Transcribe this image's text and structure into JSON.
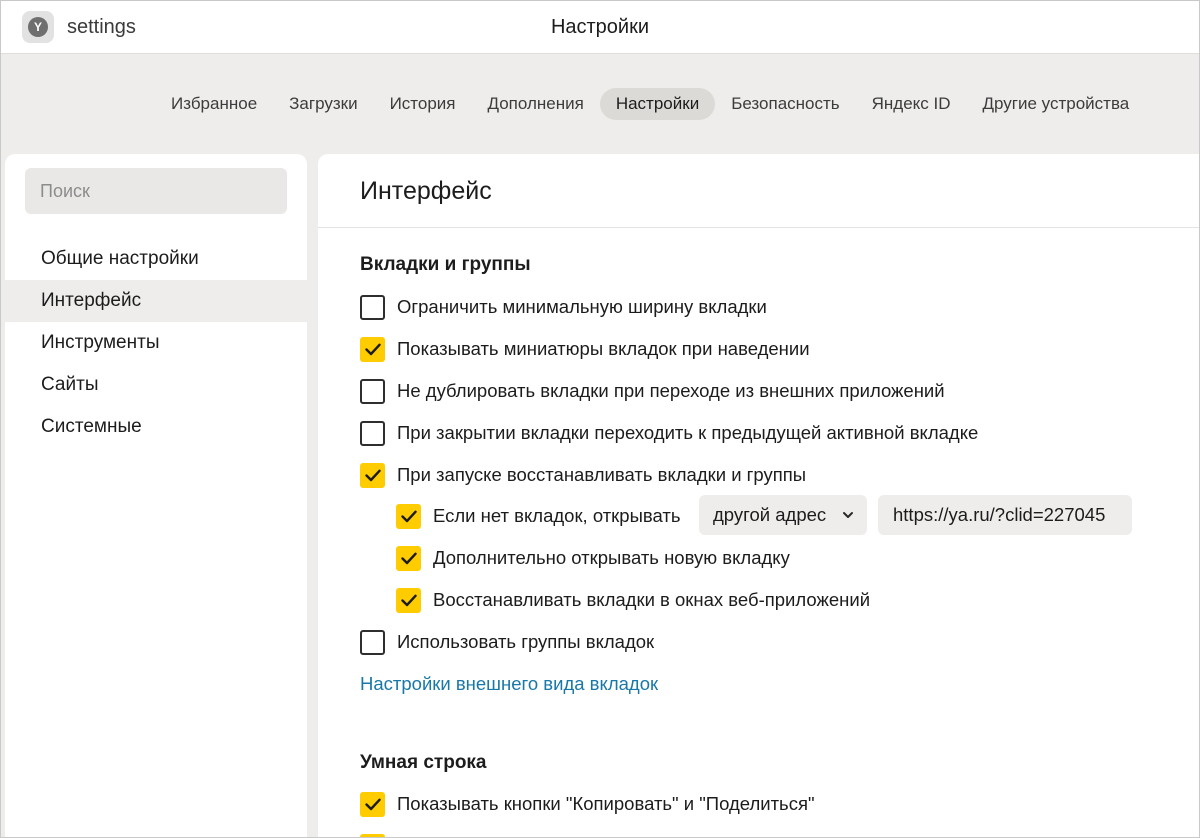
{
  "titlebar": {
    "tab_title": "settings",
    "window_title": "Настройки",
    "app_icon": "yandex-logo-icon"
  },
  "nav": {
    "items": [
      {
        "label": "Избранное",
        "active": false
      },
      {
        "label": "Загрузки",
        "active": false
      },
      {
        "label": "История",
        "active": false
      },
      {
        "label": "Дополнения",
        "active": false
      },
      {
        "label": "Настройки",
        "active": true
      },
      {
        "label": "Безопасность",
        "active": false
      },
      {
        "label": "Яндекс ID",
        "active": false
      },
      {
        "label": "Другие устройства",
        "active": false
      }
    ]
  },
  "sidebar": {
    "search_placeholder": "Поиск",
    "items": [
      {
        "label": "Общие настройки",
        "active": false
      },
      {
        "label": "Интерфейс",
        "active": true
      },
      {
        "label": "Инструменты",
        "active": false
      },
      {
        "label": "Сайты",
        "active": false
      },
      {
        "label": "Системные",
        "active": false
      }
    ]
  },
  "main": {
    "title": "Интерфейс",
    "tabs_section": {
      "title": "Вкладки и группы",
      "options": [
        {
          "label": "Ограничить минимальную ширину вкладки",
          "checked": false
        },
        {
          "label": "Показывать миниатюры вкладок при наведении",
          "checked": true
        },
        {
          "label": "Не дублировать вкладки при переходе из внешних приложений",
          "checked": false
        },
        {
          "label": "При закрытии вкладки переходить к предыдущей активной вкладке",
          "checked": false
        },
        {
          "label": "При запуске восстанавливать вкладки и группы",
          "checked": true
        }
      ],
      "sub_options": [
        {
          "label": "Если нет вкладок, открывать",
          "checked": true
        },
        {
          "label": "Дополнительно открывать новую вкладку",
          "checked": true
        },
        {
          "label": "Восстанавливать вкладки в окнах веб-приложений",
          "checked": true
        }
      ],
      "open_select_value": "другой адрес",
      "open_url_value": "https://ya.ru/?clid=227045",
      "groups_option": {
        "label": "Использовать группы вкладок",
        "checked": false
      },
      "appearance_link": "Настройки внешнего вида вкладок"
    },
    "smart_section": {
      "title": "Умная строка",
      "options": [
        {
          "label": "Показывать кнопки \"Копировать\" и \"Поделиться\"",
          "checked": true
        }
      ]
    }
  },
  "colors": {
    "accent_checkbox": "#ffcc00",
    "link": "#1878a8",
    "page_background": "#efedeb"
  }
}
